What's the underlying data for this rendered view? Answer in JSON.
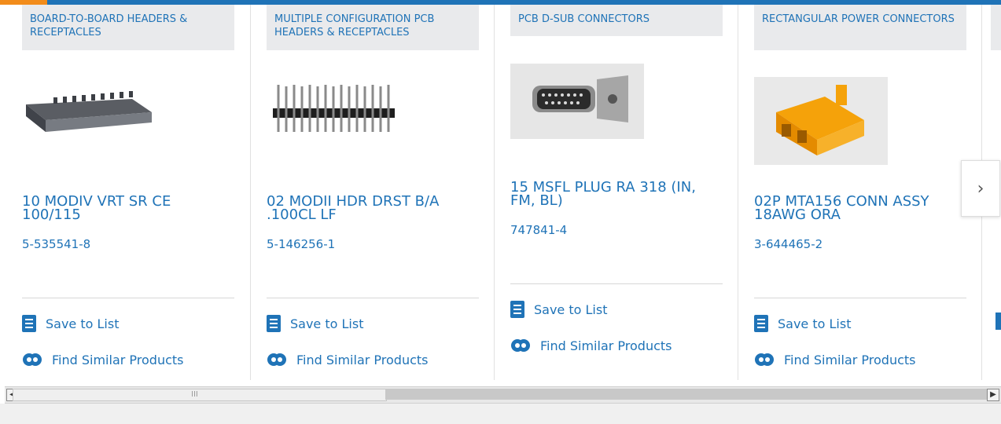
{
  "products": [
    {
      "category": "BOARD-TO-BOARD HEADERS & RECEPTACLES",
      "title": "10 MODIV VRT SR CE 100/115",
      "part_number": "5-535541-8",
      "save_label": "Save to List",
      "similar_label": "Find Similar Products",
      "image_desc": "board-header-connector"
    },
    {
      "category": "MULTIPLE CONFIGURATION PCB HEADERS & RECEPTACLES",
      "title": "02 MODII HDR DRST B/A .100CL LF",
      "part_number": "5-146256-1",
      "save_label": "Save to List",
      "similar_label": "Find Similar Products",
      "image_desc": "pin-header-connector"
    },
    {
      "category": "PCB D-SUB CONNECTORS",
      "title": "15 MSFL PLUG RA 318 (IN, FM, BL)",
      "part_number": "747841-4",
      "save_label": "Save to List",
      "similar_label": "Find Similar Products",
      "image_desc": "d-sub-connector"
    },
    {
      "category": "RECTANGULAR POWER CONNECTORS",
      "title": "02P MTA156 CONN ASSY 18AWG ORA",
      "part_number": "3-644465-2",
      "save_label": "Save to List",
      "similar_label": "Find Similar Products",
      "image_desc": "orange-power-connector"
    }
  ],
  "colors": {
    "link": "#1f73b7",
    "category_bg": "#e9eaec",
    "accent": "#f28c1b"
  },
  "nav": {
    "next_icon": "chevron-right-icon",
    "next_glyph": "›"
  },
  "scrollbar": {
    "left_arrow": "◀",
    "right_arrow": "▶",
    "thumb_grip": "III"
  }
}
